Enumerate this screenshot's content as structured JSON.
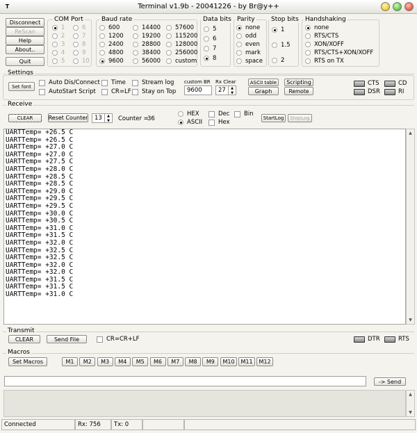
{
  "window": {
    "title": "Terminal v1.9b - 20041226 - by Br@y++",
    "icon_text": "T"
  },
  "left_buttons": {
    "disconnect": "Disconnect",
    "rescan": "ReScan",
    "help": "Help",
    "about": "About..",
    "quit": "Quit"
  },
  "com_port": {
    "label": "COM Port",
    "options": [
      "1",
      "2",
      "3",
      "4",
      "5",
      "6",
      "7",
      "8",
      "9",
      "10"
    ],
    "selected": "1"
  },
  "baud_rate": {
    "label": "Baud rate",
    "col1": [
      "600",
      "1200",
      "2400",
      "4800",
      "9600"
    ],
    "col2": [
      "14400",
      "19200",
      "28800",
      "38400",
      "56000"
    ],
    "col3": [
      "57600",
      "115200",
      "128000",
      "256000",
      "custom"
    ],
    "selected": "9600"
  },
  "data_bits": {
    "label": "Data bits",
    "options": [
      "5",
      "6",
      "7",
      "8"
    ],
    "selected": "8"
  },
  "parity": {
    "label": "Parity",
    "options": [
      "none",
      "odd",
      "even",
      "mark",
      "space"
    ],
    "selected": "none"
  },
  "stop_bits": {
    "label": "Stop bits",
    "options": [
      "1",
      "1.5",
      "2"
    ],
    "selected": "1"
  },
  "handshaking": {
    "label": "Handshaking",
    "options": [
      "none",
      "RTS/CTS",
      "XON/XOFF",
      "RTS/CTS+XON/XOFF",
      "RTS on TX"
    ],
    "selected": "none"
  },
  "settings": {
    "label": "Settings",
    "set_font": "Set font",
    "auto_dis": "Auto Dis/Connect",
    "autostart": "AutoStart Script",
    "time": "Time",
    "crlf": "CR=LF",
    "stream_log": "Stream log",
    "stay_on_top": "Stay on Top",
    "custom_br_label": "custom BR",
    "custom_br_value": "9600",
    "rx_clear_label": "Rx Clear",
    "rx_clear_value": "27",
    "ascii_table": "ASCII table",
    "graph": "Graph",
    "scripting": "Scripting",
    "remote": "Remote",
    "cts": "CTS",
    "cd": "CD",
    "dsr": "DSR",
    "ri": "RI"
  },
  "receive": {
    "label": "Receive",
    "clear": "CLEAR",
    "reset_counter": "Reset Counter",
    "counter_spin": "13",
    "counter_label": "Counter =",
    "counter_value": "36",
    "hex": "HEX",
    "ascii": "ASCII",
    "dec": "Dec",
    "hex_chk": "Hex",
    "bin": "Bin",
    "start_log": "StartLog",
    "stop_log": "StopLog",
    "lines": [
      "UARTTemp= +26.5 C",
      "UARTTemp= +26.5 C",
      "UARTTemp= +27.0 C",
      "UARTTemp= +27.0 C",
      "UARTTemp= +27.5 C",
      "UARTTemp= +28.0 C",
      "UARTTemp= +28.5 C",
      "UARTTemp= +28.5 C",
      "UARTTemp= +29.0 C",
      "UARTTemp= +29.5 C",
      "UARTTemp= +29.5 C",
      "UARTTemp= +30.0 C",
      "UARTTemp= +30.5 C",
      "UARTTemp= +31.0 C",
      "UARTTemp= +31.5 C",
      "UARTTemp= +32.0 C",
      "UARTTemp= +32.5 C",
      "UARTTemp= +32.5 C",
      "UARTTemp= +32.0 C",
      "UARTTemp= +32.0 C",
      "UARTTemp= +31.5 C",
      "UARTTemp= +31.5 C",
      "UARTTemp= +31.0 C"
    ]
  },
  "transmit": {
    "label": "Transmit",
    "clear": "CLEAR",
    "send_file": "Send File",
    "crcrlf": "CR=CR+LF",
    "dtr": "DTR",
    "rts": "RTS"
  },
  "macros": {
    "label": "Macros",
    "set_macros": "Set Macros",
    "buttons": [
      "M1",
      "M2",
      "M3",
      "M4",
      "M5",
      "M6",
      "M7",
      "M8",
      "M9",
      "M10",
      "M11",
      "M12"
    ]
  },
  "send": {
    "input_value": "",
    "button": "-> Send"
  },
  "status": {
    "connection": "Connected",
    "rx": "Rx: 756",
    "tx": "Tx: 0"
  }
}
